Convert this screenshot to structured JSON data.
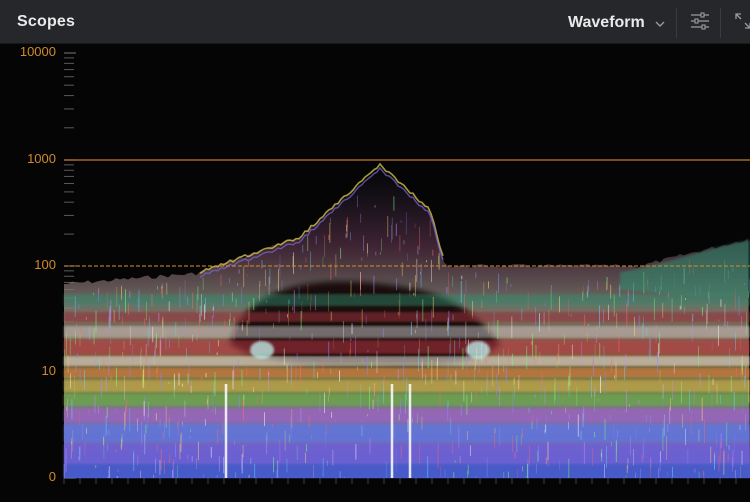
{
  "panel": {
    "title": "Scopes",
    "mode": "Waveform",
    "icons": {
      "mode_dropdown": "chevron-down-icon",
      "settings": "sliders-icon",
      "expand": "expand-icon"
    }
  },
  "scope": {
    "scale": "log",
    "unit": "nits",
    "scale_color": "#d08a2b",
    "tick_labels": [
      "10000",
      "1000",
      "100",
      "10",
      "0"
    ]
  }
}
